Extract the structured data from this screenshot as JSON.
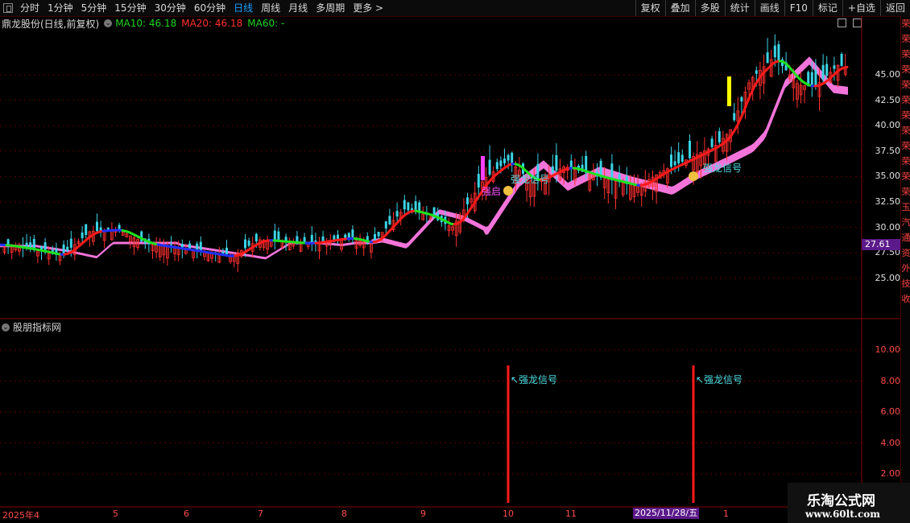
{
  "toolbar": {
    "left": [
      "分时",
      "1分钟",
      "5分钟",
      "15分钟",
      "30分钟",
      "60分钟",
      "日线",
      "周线",
      "月线",
      "多周期",
      "更多 >"
    ],
    "active": "日线",
    "right": [
      "复权",
      "叠加",
      "多股",
      "统计",
      "画线",
      "F10",
      "标记",
      "+自选",
      "返回"
    ]
  },
  "header": {
    "stock_title": "鼎龙股份(日线,前复权)",
    "ma10": "MA10: 46.18",
    "ma20": "MA20: 46.18",
    "ma60": "MA60: -"
  },
  "price_axis": [
    "45.00",
    "42.50",
    "40.00",
    "37.50",
    "35.00",
    "32.50",
    "30.00",
    "27.50",
    "25.00"
  ],
  "current_price": "27.61",
  "indicator": {
    "title": "股朋指标网",
    "axis": [
      "10.00",
      "8.00",
      "6.00",
      "4.00",
      "2.00"
    ],
    "signal_label": "↖强龙信号"
  },
  "signals": {
    "main_1": "强龙信号",
    "main_2": "强龙信号",
    "start": "强启"
  },
  "date_axis": {
    "first": "2025年4",
    "months": [
      "5",
      "6",
      "7",
      "8",
      "9",
      "10",
      "11",
      "1"
    ],
    "selected": "2025/11/28/五"
  },
  "right_strip": [
    "荣",
    "荣",
    "荣",
    "荣",
    "荣",
    "荣",
    "荣",
    "荣",
    "荣",
    "荣",
    "荣",
    "荣",
    "玉",
    "汽",
    "通",
    "资",
    "外",
    "技",
    "收"
  ],
  "watermark": {
    "name": "乐淘公式网",
    "url": "www.60lt.com"
  },
  "colors": {
    "up": "#ff3030",
    "down": "#3ad4e6",
    "ma_up": "#ff1a1a",
    "ma_down": "#1fe01f",
    "ma_flat": "#2030ff",
    "band": "#ff7ae6",
    "grid": "#5a0000"
  },
  "chart_data": {
    "type": "candlestick",
    "price_range": [
      22.5,
      47.5
    ],
    "indicator_signal_value": 9,
    "indicator_range": [
      0,
      12
    ]
  }
}
